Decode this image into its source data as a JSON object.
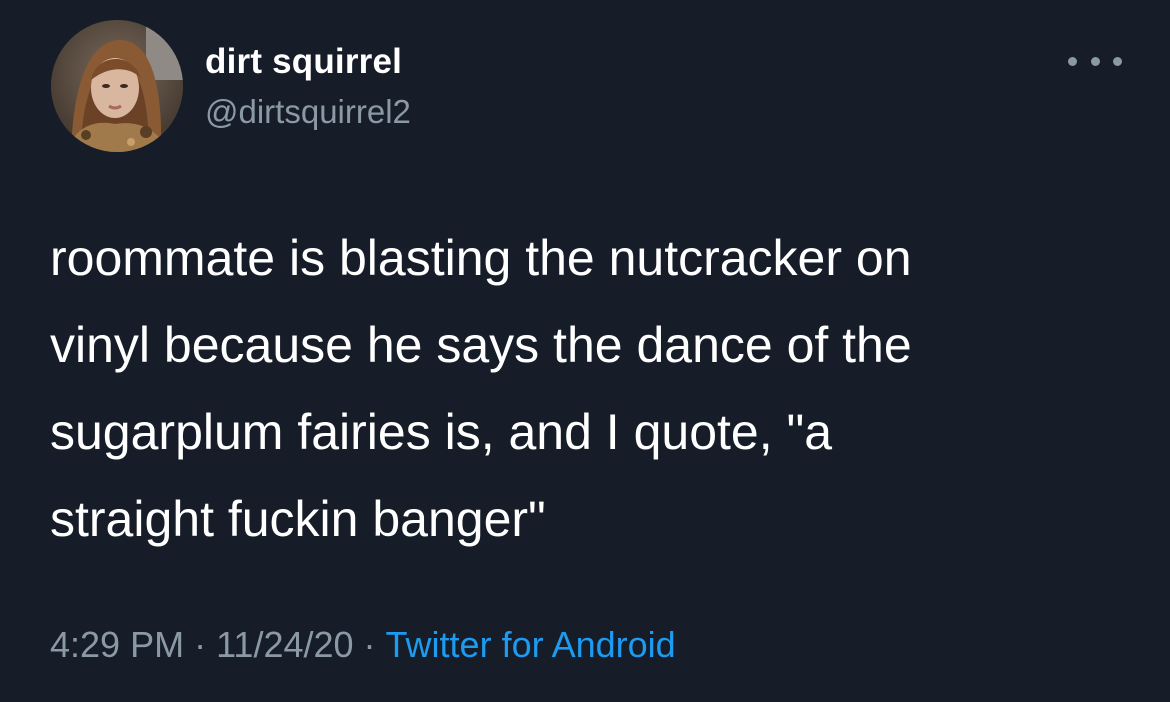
{
  "author": {
    "display_name": "dirt squirrel",
    "handle": "@dirtsquirrel2"
  },
  "tweet": {
    "text_lines": [
      "roommate is blasting the nutcracker on",
      "vinyl because he says the dance of the",
      "sugarplum fairies is, and I quote, \"a",
      "straight fuckin banger\""
    ]
  },
  "meta": {
    "time": "4:29 PM",
    "separator": "·",
    "date": "11/24/20",
    "source": "Twitter for Android"
  },
  "icons": {
    "more": "more-horizontal-icon"
  },
  "colors": {
    "background": "#161d28",
    "text_primary": "#ffffff",
    "text_secondary": "#8b98a5",
    "link": "#1d9bf0"
  }
}
